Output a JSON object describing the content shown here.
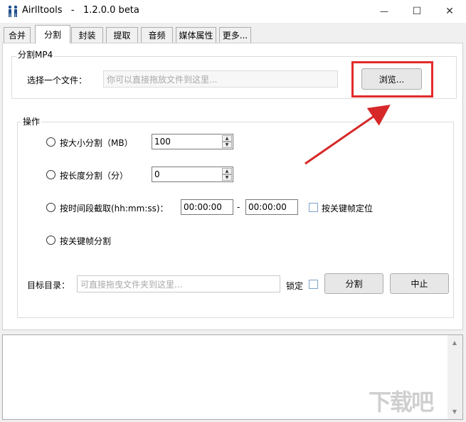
{
  "window": {
    "title": "Airlltools   -   1.2.0.0 beta",
    "controls": {
      "minimize": "—",
      "maximize": "☐",
      "close": "✕"
    }
  },
  "tabs": [
    {
      "label": "合并",
      "active": false
    },
    {
      "label": "分割",
      "active": true
    },
    {
      "label": "封装",
      "active": false
    },
    {
      "label": "提取",
      "active": false
    },
    {
      "label": "音频",
      "active": false
    },
    {
      "label": "媒体属性",
      "active": false
    },
    {
      "label": "更多...",
      "active": false
    }
  ],
  "split_group": {
    "title": "分割MP4",
    "file_label": "选择一个文件：",
    "file_placeholder": "你可以直接拖放文件到这里...",
    "browse_button": "浏览..."
  },
  "operation_group": {
    "title": "操作",
    "by_size": {
      "label": "按大小分割（MB）",
      "value": "100"
    },
    "by_length": {
      "label": "按长度分割（分）",
      "value": "0"
    },
    "by_time": {
      "label": "按时间段截取(hh:mm:ss)：",
      "start": "00:00:00",
      "separator": "-",
      "end": "00:00:00",
      "keyframe_label": "按关键帧定位"
    },
    "by_keyframe": {
      "label": "按关键帧分割"
    }
  },
  "target": {
    "label": "目标目录：",
    "placeholder": "可直接拖曳文件夹到这里...",
    "lock_label": "锁定",
    "split_button": "分割",
    "stop_button": "中止"
  },
  "watermark": "下载吧",
  "colors": {
    "highlight": "#e32b2b",
    "arrow": "#d62828"
  }
}
